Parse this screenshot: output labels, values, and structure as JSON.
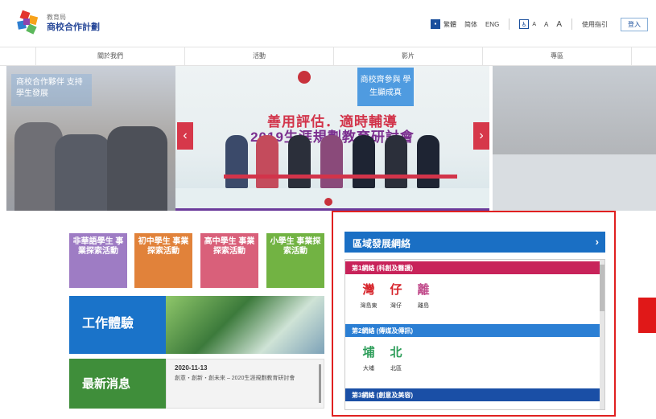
{
  "header": {
    "logo_sub": "教育局",
    "logo_main": "商校合作計劃",
    "links": [
      "繁體",
      "简体",
      "ENG"
    ],
    "font_sizes": [
      "A",
      "A",
      "A"
    ],
    "guide": "使用指引",
    "login": "登入"
  },
  "nav": [
    "關於我們",
    "活動",
    "影片",
    "專區"
  ],
  "banner": {
    "left_caption": "商校合作夥伴 支持學生發展",
    "mid_caption": "商校齊參與 學生顯成真",
    "mid_title_1": "善用評估．適時輔導",
    "mid_title_2": "2019生涯規劃教育研討會",
    "prev": "‹",
    "next": "›"
  },
  "tiles": [
    {
      "label": "非華語學生 事業探索活動",
      "color": "#9e7cc4"
    },
    {
      "label": "初中學生 事業探索活動",
      "color": "#e1823a"
    },
    {
      "label": "高中學生 事業探索活動",
      "color": "#d9607a"
    },
    {
      "label": "小學生 事業探索活動",
      "color": "#72b343"
    }
  ],
  "work": {
    "label": "工作體驗"
  },
  "news": {
    "label": "最新消息",
    "date": "2020-11-13",
    "text": "創意・創新・創未來 – 2020生涯規劃教育研討會"
  },
  "district_panel": {
    "title": "區域發展網絡",
    "networks": [
      {
        "name": "第1網絡 (科創及醫護)",
        "color": "#c8235a",
        "districts": [
          {
            "name": "灣島東",
            "icon": "灣",
            "color": "#d6232a"
          },
          {
            "name": "灣仔",
            "icon": "仔",
            "color": "#d6232a"
          },
          {
            "name": "離島",
            "icon": "離",
            "color": "#c04a8a"
          }
        ]
      },
      {
        "name": "第2網絡 (傳媒及傳訊)",
        "color": "#2b7fd4",
        "districts": [
          {
            "name": "大埔",
            "icon": "埔",
            "color": "#2e9e5a"
          },
          {
            "name": "北區",
            "icon": "北",
            "color": "#2e9e5a"
          }
        ]
      },
      {
        "name": "第3網絡 (創意及美容)",
        "color": "#1a4fa6",
        "districts": []
      }
    ]
  }
}
